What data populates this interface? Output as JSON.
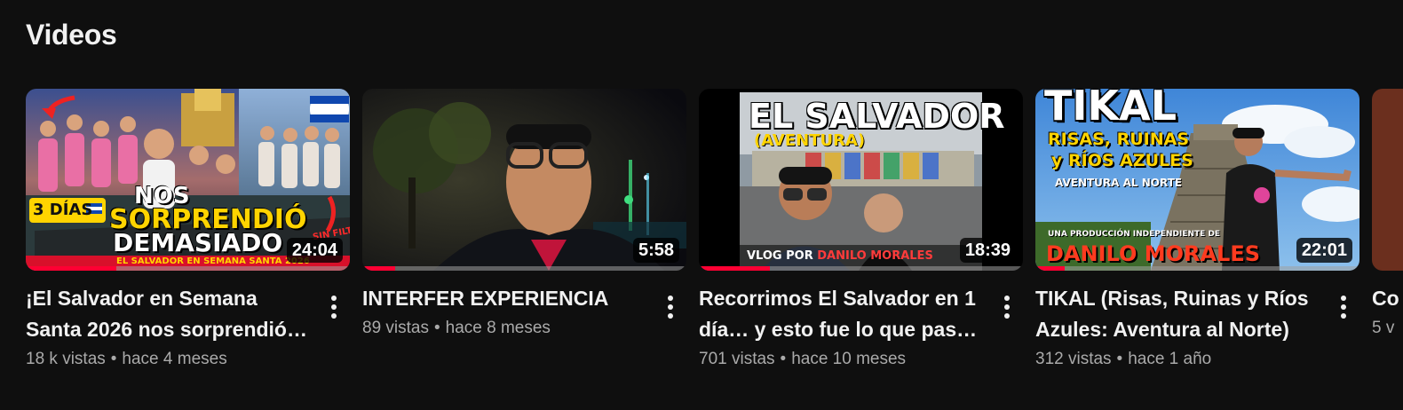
{
  "section": {
    "title": "Videos"
  },
  "videos": [
    {
      "title": "¡El Salvador en Semana Santa 2026 nos sorprendió …",
      "views": "18 k vistas",
      "age": "hace 4 meses",
      "duration": "24:04",
      "progress": 0.28,
      "thumb": {
        "badge": "3 DÍAS",
        "line1": "NOS",
        "line2": "SORPRENDIÓ",
        "line3": "DEMASIADO",
        "footer": "EL SALVADOR EN SEMANA SANTA 2026",
        "corner": "SIN FILTRO"
      }
    },
    {
      "title": "INTERFER EXPERIENCIA",
      "views": "89 vistas",
      "age": "hace 8 meses",
      "duration": "5:58",
      "progress": 0.1
    },
    {
      "title": "Recorrimos El Salvador en 1 día… y esto fue lo que pasó …",
      "views": "701 vistas",
      "age": "hace 10 meses",
      "duration": "18:39",
      "progress": 0.22,
      "thumb": {
        "heading": "EL SALVADOR",
        "subheading": "(AVENTURA)",
        "footer_a": "VLOG POR",
        "footer_b": "DANILO MORALES"
      }
    },
    {
      "title": "TIKAL (Risas, Ruinas y Ríos Azules: Aventura al Norte)",
      "views": "312 vistas",
      "age": "hace 1 año",
      "duration": "22:01",
      "progress": 0.09,
      "thumb": {
        "heading": "TIKAL",
        "sub1": "RISAS, RUINAS",
        "sub2": "y RÍOS AZULES",
        "sub3": "AVENTURA AL NORTE",
        "credit": "UNA PRODUCCIÓN INDEPENDIENTE DE",
        "name": "DANILO MORALES"
      }
    },
    {
      "title": "Co",
      "views": "5 v"
    }
  ],
  "colors": {
    "background": "#0f0f0f",
    "text_primary": "#f1f1f1",
    "text_secondary": "#aaaaaa",
    "progress": "#ff0033"
  },
  "icons": {
    "more": "more-vert-icon"
  }
}
